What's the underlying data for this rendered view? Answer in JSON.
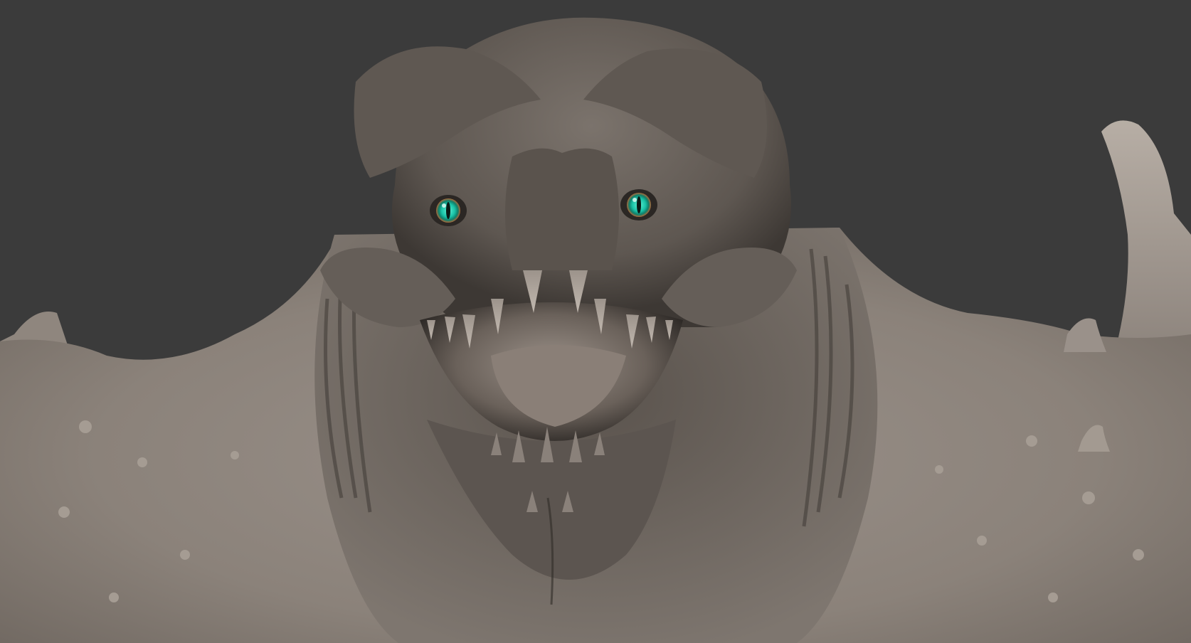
{
  "scene": {
    "subject": "sculpted-creature-bust",
    "colors": {
      "background": "#3b3b3b",
      "skin_light": "#a39a91",
      "skin_mid": "#857c74",
      "skin_dark": "#4a443f",
      "shadow": "#2b2724",
      "mouth_interior": "#8a7f77",
      "iris": "#19c2a6",
      "iris_ring": "#b06a3a",
      "pupil": "#0a1a16"
    },
    "icons": {
      "left_eye": "eye-icon",
      "right_eye": "eye-icon"
    }
  }
}
